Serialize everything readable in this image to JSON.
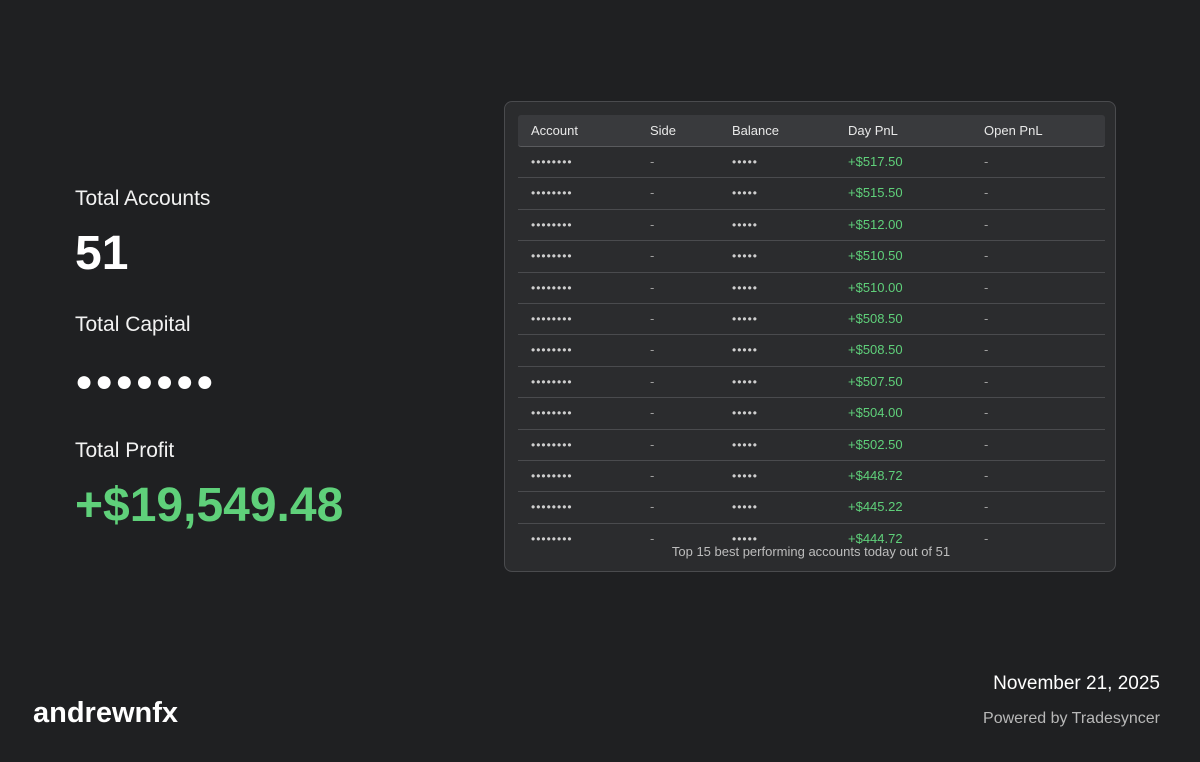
{
  "stats": {
    "accounts_label": "Total Accounts",
    "accounts_value": "51",
    "capital_label": "Total Capital",
    "capital_value": "●●●●●●●",
    "profit_label": "Total Profit",
    "profit_value": "+$19,549.48",
    "profit_color": "#5fd07a"
  },
  "table": {
    "columns": [
      "Account",
      "Side",
      "Balance",
      "Day PnL",
      "Open PnL"
    ],
    "rows": [
      {
        "account": "••••••••",
        "side": "-",
        "balance": "•••••",
        "day_pnl": "+$517.50",
        "open_pnl": "-"
      },
      {
        "account": "••••••••",
        "side": "-",
        "balance": "•••••",
        "day_pnl": "+$515.50",
        "open_pnl": "-"
      },
      {
        "account": "••••••••",
        "side": "-",
        "balance": "•••••",
        "day_pnl": "+$512.00",
        "open_pnl": "-"
      },
      {
        "account": "••••••••",
        "side": "-",
        "balance": "•••••",
        "day_pnl": "+$510.50",
        "open_pnl": "-"
      },
      {
        "account": "••••••••",
        "side": "-",
        "balance": "•••••",
        "day_pnl": "+$510.00",
        "open_pnl": "-"
      },
      {
        "account": "••••••••",
        "side": "-",
        "balance": "•••••",
        "day_pnl": "+$508.50",
        "open_pnl": "-"
      },
      {
        "account": "••••••••",
        "side": "-",
        "balance": "•••••",
        "day_pnl": "+$508.50",
        "open_pnl": "-"
      },
      {
        "account": "••••••••",
        "side": "-",
        "balance": "•••••",
        "day_pnl": "+$507.50",
        "open_pnl": "-"
      },
      {
        "account": "••••••••",
        "side": "-",
        "balance": "•••••",
        "day_pnl": "+$504.00",
        "open_pnl": "-"
      },
      {
        "account": "••••••••",
        "side": "-",
        "balance": "•••••",
        "day_pnl": "+$502.50",
        "open_pnl": "-"
      },
      {
        "account": "••••••••",
        "side": "-",
        "balance": "•••••",
        "day_pnl": "+$448.72",
        "open_pnl": "-"
      },
      {
        "account": "••••••••",
        "side": "-",
        "balance": "•••••",
        "day_pnl": "+$445.22",
        "open_pnl": "-"
      },
      {
        "account": "••••••••",
        "side": "-",
        "balance": "•••••",
        "day_pnl": "+$444.72",
        "open_pnl": "-"
      }
    ],
    "caption": "Top 15 best performing accounts today out of 51"
  },
  "footer": {
    "username": "andrewnfx",
    "date": "November 21, 2025",
    "powered_by": "Powered by Tradesyncer"
  },
  "colors": {
    "background": "#1f2022",
    "panel": "#2b2c2e",
    "header": "#393a3d",
    "positive": "#5fd07a"
  }
}
